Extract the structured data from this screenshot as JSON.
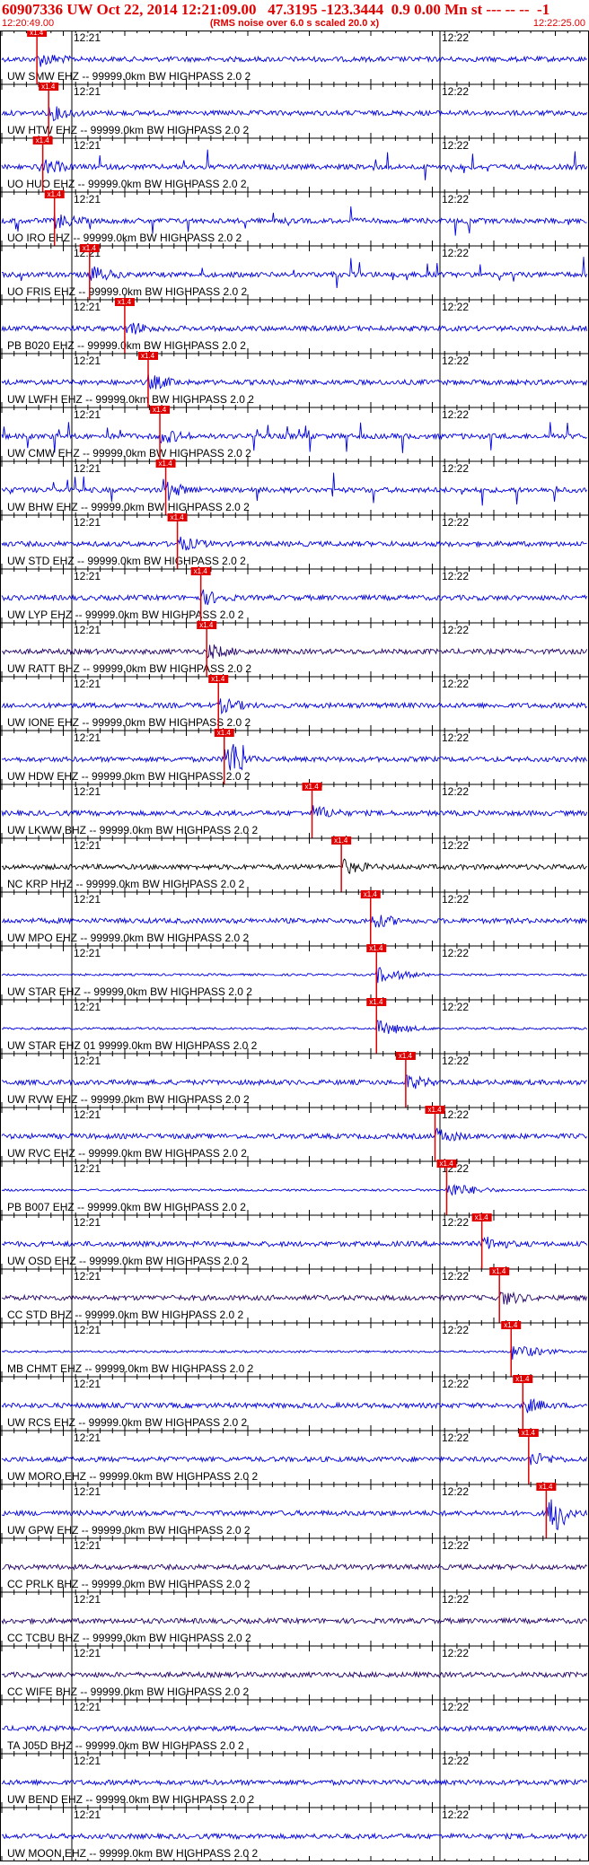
{
  "header": {
    "title": "60907336 UW Oct 22, 2014 12:21:09.00   47.3195 -123.3444  0.9 0.00 Mn st --- -- --  -1",
    "start_time": "12:20:49.00",
    "note": "(RMS noise over 6.0 s scaled 20.0 x)",
    "end_time": "12:22:25.00"
  },
  "chart_data": {
    "type": "line",
    "title": "60907336 UW Oct 22, 2014 12:21:09.00   47.3195 -123.3444  0.9 0.00 Mn st --- -- --  -1",
    "x_range": [
      "12:20:49.00",
      "12:22:25.00"
    ],
    "time_labels": [
      "12:21",
      "12:22"
    ],
    "pick_label": "x1.4",
    "colors": {
      "trace": "#0000dd",
      "trace_dark": "#220066",
      "trace_black": "#000000",
      "pick": "#e00000",
      "grid": "#000000"
    },
    "channels": [
      {
        "name": "UW SMW EHZ -- 99999.0km BW  HIGHPASS  2.0  2",
        "pick_frac": 0.06,
        "color": "trace",
        "style": "normal"
      },
      {
        "name": "UW HTW EHZ -- 99999.0km BW  HIGHPASS  2.0  2",
        "pick_frac": 0.08,
        "color": "trace",
        "style": "normal"
      },
      {
        "name": "UO HUO EHZ -- 99999.0km BW  HIGHPASS  2.0  2",
        "pick_frac": 0.07,
        "color": "trace",
        "style": "spiky"
      },
      {
        "name": "UO IRO EHZ -- 99999.0km BW  HIGHPASS  2.0  2",
        "pick_frac": 0.09,
        "color": "trace",
        "style": "spiky"
      },
      {
        "name": "UO FRIS EHZ -- 99999.0km BW  HIGHPASS  2.0  2",
        "pick_frac": 0.15,
        "color": "trace",
        "style": "spiky"
      },
      {
        "name": "PB B020 EHZ -- 99999.0km BW  HIGHPASS  2.0  2",
        "pick_frac": 0.21,
        "color": "trace",
        "style": "normal"
      },
      {
        "name": "UW LWFH EHZ -- 99999.0km BW  HIGHPASS  2.0  2",
        "pick_frac": 0.25,
        "color": "trace",
        "style": "normal"
      },
      {
        "name": "UW CMW EHZ -- 99999.0km BW  HIGHPASS  2.0  2",
        "pick_frac": 0.27,
        "color": "trace",
        "style": "spiky"
      },
      {
        "name": "UW BHW EHZ -- 99999.0km BW  HIGHPASS  2.0  2",
        "pick_frac": 0.28,
        "color": "trace",
        "style": "spiky"
      },
      {
        "name": "UW STD EHZ -- 99999.0km BW  HIGHPASS  2.0  2",
        "pick_frac": 0.3,
        "color": "trace",
        "style": "normal"
      },
      {
        "name": "UW LYP EHZ -- 99999.0km BW  HIGHPASS  2.0  2",
        "pick_frac": 0.34,
        "color": "trace",
        "style": "normal"
      },
      {
        "name": "UW RATT BHZ -- 99999.0km BW  HIGHPASS  2.0  2",
        "pick_frac": 0.35,
        "color": "trace_dark",
        "style": "normal"
      },
      {
        "name": "UW IONE EHZ -- 99999.0km BW  HIGHPASS  2.0  2",
        "pick_frac": 0.37,
        "color": "trace",
        "style": "normal"
      },
      {
        "name": "UW HDW EHZ -- 99999.0km BW  HIGHPASS  2.0  2",
        "pick_frac": 0.38,
        "color": "trace",
        "style": "burst"
      },
      {
        "name": "UW LKWW BHZ -- 99999.0km BW  HIGHPASS  2.0  2",
        "pick_frac": 0.53,
        "color": "trace",
        "style": "normal"
      },
      {
        "name": "NC KRP HHZ -- 99999.0km BW  HIGHPASS  2.0  2",
        "pick_frac": 0.58,
        "color": "trace_black",
        "style": "normal"
      },
      {
        "name": "UW MPO EHZ -- 99999.0km BW  HIGHPASS  2.0  2",
        "pick_frac": 0.63,
        "color": "trace",
        "style": "normal"
      },
      {
        "name": "UW STAR EHZ -- 99999.0km BW  HIGHPASS  2.0  2",
        "pick_frac": 0.64,
        "color": "trace",
        "style": "quiet"
      },
      {
        "name": "UW STAR EHZ 01 99999.0km BW  HIGHPASS  2.0  2",
        "pick_frac": 0.64,
        "color": "trace",
        "style": "quiet"
      },
      {
        "name": "UW RVW EHZ -- 99999.0km BW  HIGHPASS  2.0  2",
        "pick_frac": 0.69,
        "color": "trace",
        "style": "normal"
      },
      {
        "name": "UW RVC EHZ -- 99999.0km BW  HIGHPASS  2.0  2",
        "pick_frac": 0.74,
        "color": "trace",
        "style": "normal"
      },
      {
        "name": "PB B007 EHZ -- 99999.0km BW  HIGHPASS  2.0  2",
        "pick_frac": 0.76,
        "color": "trace",
        "style": "quiet"
      },
      {
        "name": "UW OSD EHZ -- 99999.0km BW  HIGHPASS  2.0  2",
        "pick_frac": 0.82,
        "color": "trace",
        "style": "normal"
      },
      {
        "name": "CC STD BHZ -- 99999.0km BW  HIGHPASS  2.0  2",
        "pick_frac": 0.85,
        "color": "trace_dark",
        "style": "normal"
      },
      {
        "name": "MB CHMT EHZ -- 99999.0km BW  HIGHPASS  2.0  2",
        "pick_frac": 0.87,
        "color": "trace",
        "style": "quiet"
      },
      {
        "name": "UW RCS EHZ -- 99999.0km BW  HIGHPASS  2.0  2",
        "pick_frac": 0.89,
        "color": "trace",
        "style": "normal"
      },
      {
        "name": "UW MORO EHZ -- 99999.0km BW  HIGHPASS  2.0  2",
        "pick_frac": 0.9,
        "color": "trace",
        "style": "normal"
      },
      {
        "name": "UW GPW EHZ -- 99999.0km BW  HIGHPASS  2.0  2",
        "pick_frac": 0.93,
        "color": "trace",
        "style": "burst"
      },
      {
        "name": "CC PRLK BHZ -- 99999.0km BW  HIGHPASS  2.0  2",
        "pick_frac": null,
        "color": "trace_dark",
        "style": "normal"
      },
      {
        "name": "CC TCBU BHZ -- 99999.0km BW  HIGHPASS  2.0  2",
        "pick_frac": null,
        "color": "trace_dark",
        "style": "normal"
      },
      {
        "name": "CC WIFE BHZ -- 99999.0km BW  HIGHPASS  2.0  2",
        "pick_frac": null,
        "color": "trace_dark",
        "style": "normal"
      },
      {
        "name": "TA J05D BHZ -- 99999.0km BW  HIGHPASS  2.0  2",
        "pick_frac": null,
        "color": "trace",
        "style": "normal"
      },
      {
        "name": "UW BEND EHZ -- 99999.0km BW  HIGHPASS  2.0  2",
        "pick_frac": null,
        "color": "trace",
        "style": "normal"
      },
      {
        "name": "UW MOON EHZ -- 99999.0km BW  HIGHPASS  2.0  2",
        "pick_frac": null,
        "color": "trace",
        "style": "normal"
      }
    ]
  }
}
